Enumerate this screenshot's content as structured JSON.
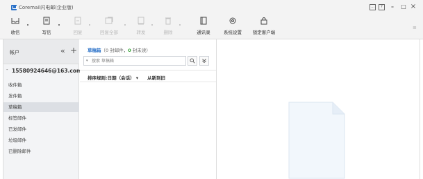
{
  "window": {
    "title": "Coremail闪电邮(企业版)"
  },
  "toolbar": {
    "buttons": [
      {
        "label": "收信",
        "icon": "receive-mail-icon",
        "enabled": true
      },
      {
        "label": "写信",
        "icon": "compose-icon",
        "enabled": true
      },
      {
        "label": "回复",
        "icon": "reply-icon",
        "enabled": false
      },
      {
        "label": "回复全部",
        "icon": "reply-all-icon",
        "enabled": false
      },
      {
        "label": "转发",
        "icon": "forward-icon",
        "enabled": false
      },
      {
        "label": "删除",
        "icon": "delete-icon",
        "enabled": false
      },
      {
        "label": "通讯录",
        "icon": "contacts-icon",
        "enabled": true
      },
      {
        "label": "系统设置",
        "icon": "gear-icon",
        "enabled": true
      },
      {
        "label": "锁定客户端",
        "icon": "lock-icon",
        "enabled": true
      }
    ]
  },
  "sidebar": {
    "header": "帐户",
    "account": "15580924646@163.com",
    "folders": [
      {
        "label": "收件箱",
        "active": false
      },
      {
        "label": "发件箱",
        "active": false
      },
      {
        "label": "草稿箱",
        "active": true
      },
      {
        "label": "标签邮件",
        "active": false
      },
      {
        "label": "已发邮件",
        "active": false
      },
      {
        "label": "垃圾邮件",
        "active": false
      },
      {
        "label": "已删除邮件",
        "active": false
      }
    ]
  },
  "listpane": {
    "folder_name": "草稿箱",
    "count_open": "（",
    "mail_count": "0",
    "mail_unit": " 封邮件，",
    "unread_count": "0",
    "unread_unit": " 封未读",
    "count_close": "）",
    "search_placeholder": "搜索 草稿箱",
    "sort_field": "排序规则:日期（会话） ▾",
    "sort_order": "从新到旧"
  },
  "colors": {
    "accent": "#2a71c8",
    "unread_green": "#2a9d2a",
    "chrome_bg": "#f3f3f3"
  }
}
